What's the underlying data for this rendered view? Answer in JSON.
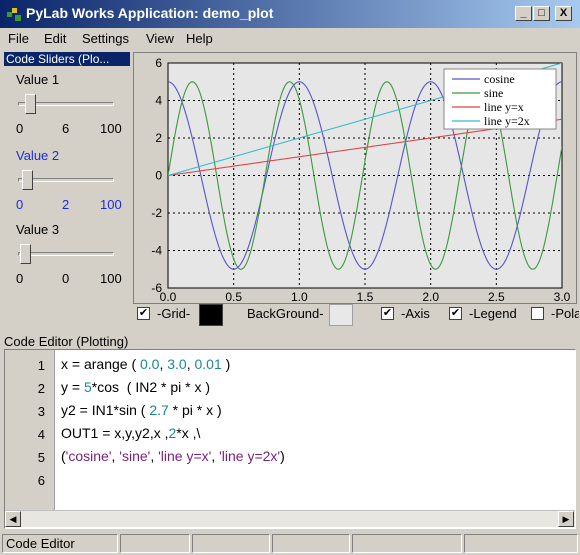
{
  "window": {
    "title": "PyLab Works Application: demo_plot",
    "minimize": "_",
    "maximize": "□",
    "close": "X"
  },
  "menu": {
    "items": [
      {
        "label": "File"
      },
      {
        "label": "Edit"
      },
      {
        "label": "Settings"
      },
      {
        "label": "View"
      },
      {
        "label": "Help"
      }
    ]
  },
  "sliders": {
    "header": "Code Sliders (Plo...",
    "items": [
      {
        "label": "Value 1",
        "min": "0",
        "value": "6",
        "max": "100",
        "fraction": 0.06,
        "highlighted": false
      },
      {
        "label": "Value 2",
        "min": "0",
        "value": "2",
        "max": "100",
        "fraction": 0.02,
        "highlighted": true
      },
      {
        "label": "Value 3",
        "min": "0",
        "value": "0",
        "max": "100",
        "fraction": 0.0,
        "highlighted": false
      }
    ]
  },
  "chart_data": {
    "type": "line",
    "xlim": [
      0.0,
      3.0
    ],
    "ylim": [
      -6,
      6
    ],
    "xticks": [
      "0.0",
      "0.5",
      "1.0",
      "1.5",
      "2.0",
      "2.5",
      "3.0"
    ],
    "yticks": [
      "6",
      "4",
      "2",
      "0",
      "-2",
      "-4",
      "-6"
    ],
    "grid": true,
    "legend_position": "top-right",
    "series": [
      {
        "name": "cosine",
        "color": "#5555cc",
        "formula": "5*cos(2*pi*x)"
      },
      {
        "name": "sine",
        "color": "#3a9a3a",
        "formula": "5*sin(2.7*pi*x)"
      },
      {
        "name": "line y=x",
        "color": "#dd4444",
        "formula": "x"
      },
      {
        "name": "line y=2x",
        "color": "#33bbcc",
        "formula": "2*x"
      }
    ]
  },
  "controls": {
    "grid": {
      "label": "-Grid-",
      "checked": true
    },
    "background": {
      "label": "BackGround-",
      "color_left": "#000000",
      "color_right": "#e8e8e8"
    },
    "axis": {
      "label": "-Axis",
      "checked": true
    },
    "legend": {
      "label": "-Legend",
      "checked": true
    },
    "polar": {
      "label": "-Polar",
      "checked": false
    }
  },
  "editor": {
    "title": "Code Editor (Plotting)",
    "line_numbers": [
      "1",
      "2",
      "3",
      "4",
      "5",
      "6"
    ],
    "lines": [
      [
        {
          "t": "x = arange ( ",
          "c": ""
        },
        {
          "t": "0.0",
          "c": "num"
        },
        {
          "t": ", ",
          "c": ""
        },
        {
          "t": "3.0",
          "c": "num"
        },
        {
          "t": ", ",
          "c": ""
        },
        {
          "t": "0.01",
          "c": "num"
        },
        {
          "t": " )",
          "c": ""
        }
      ],
      [
        {
          "t": "y = ",
          "c": ""
        },
        {
          "t": "5",
          "c": "num"
        },
        {
          "t": "*cos  ( IN2 * pi * x )",
          "c": ""
        }
      ],
      [
        {
          "t": "y2 = IN1*sin ( ",
          "c": ""
        },
        {
          "t": "2.7",
          "c": "num"
        },
        {
          "t": " * pi * x )",
          "c": ""
        }
      ],
      [
        {
          "t": "OUT1 = x,y,y2,x ,",
          "c": ""
        },
        {
          "t": "2",
          "c": "num"
        },
        {
          "t": "*x ,\\",
          "c": ""
        }
      ],
      [
        {
          "t": "(",
          "c": ""
        },
        {
          "t": "'cosine'",
          "c": "str"
        },
        {
          "t": ", ",
          "c": ""
        },
        {
          "t": "'sine'",
          "c": "str"
        },
        {
          "t": ", ",
          "c": ""
        },
        {
          "t": "'line y=x'",
          "c": "str"
        },
        {
          "t": ", ",
          "c": ""
        },
        {
          "t": "'line y=2x'",
          "c": "str"
        },
        {
          "t": ")",
          "c": ""
        }
      ],
      []
    ]
  },
  "status": {
    "text": "Code Editor"
  }
}
